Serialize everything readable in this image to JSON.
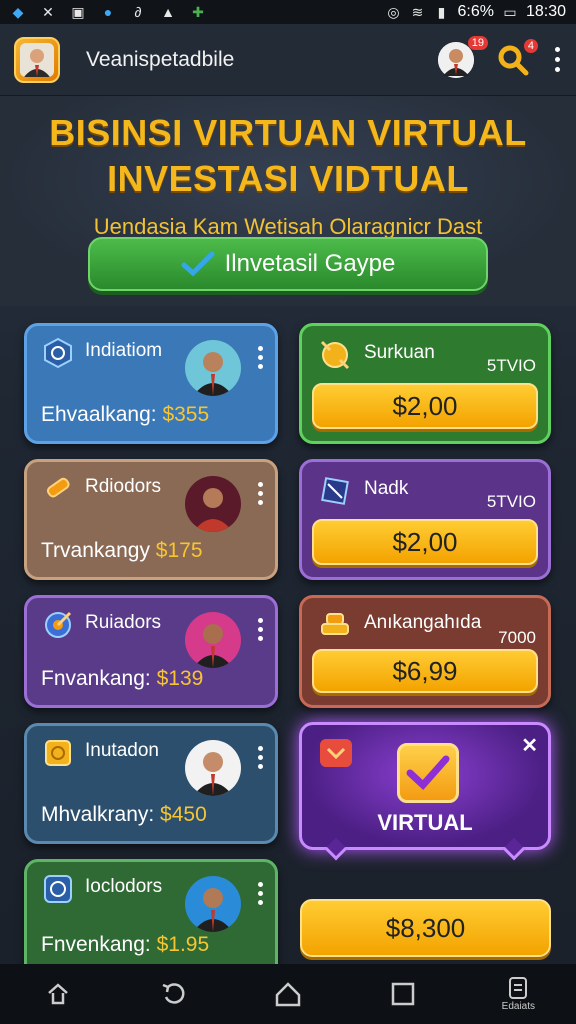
{
  "status_bar": {
    "battery": "6:6%",
    "time": "18:30"
  },
  "header": {
    "app_title": "Veanispetadbile",
    "notification_count": "19",
    "search_badge": "4"
  },
  "hero": {
    "title_line1": "BISINSI VIRTUAN VIRTUAL",
    "title_line2": "INVESTASI VIDTUAL",
    "subtitle": "Uendasia Kam Wetisah Olaragnicr Dast",
    "cta_label": "Ilnvetasil Gaype"
  },
  "left_cards": [
    {
      "title": "Indiatiom",
      "value_label": "Ehvaalkang:",
      "value": "$355",
      "color": "#3a78b8"
    },
    {
      "title": "Rdiodors",
      "value_label": "Trvankangy",
      "value": "$175",
      "color": "#8a6a55"
    },
    {
      "title": "Ruiadors",
      "value_label": "Fnvankang:",
      "value": "$139",
      "color": "#5a3b8a"
    },
    {
      "title": "Inutadon",
      "value_label": "Mhvalkrany:",
      "value": "$450",
      "color": "#2c4f6e"
    },
    {
      "title": "Ioclodors",
      "value_label": "Fnvenkang:",
      "value": "$1.95",
      "color": "#2f6a34"
    }
  ],
  "right_cards": [
    {
      "title": "Surkuan",
      "num": "5TVIO",
      "button": "$2,00",
      "color": "#2e7a2e"
    },
    {
      "title": "Nadk",
      "num": "5TVIO",
      "button": "$2,00",
      "color": "#5b3389"
    },
    {
      "title": "Anıkangahıda",
      "num": "7000",
      "button": "$6,99",
      "color": "#7a3b30"
    }
  ],
  "popup": {
    "label": "VIRTUAL",
    "close": "✕"
  },
  "bottom_button": "$8,300",
  "nav": {
    "last_label": "Edaiats"
  }
}
